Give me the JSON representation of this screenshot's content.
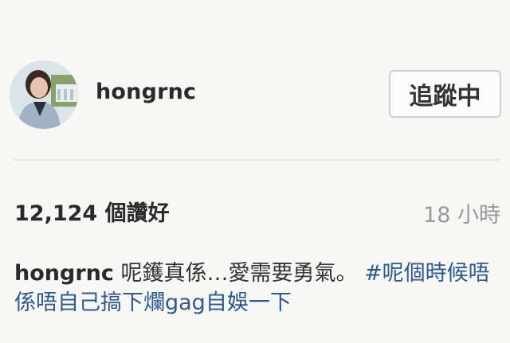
{
  "post": {
    "username": "hongrnc",
    "follow_label": "追蹤中",
    "likes_label": "12,124 個讚好",
    "time_label": "18 小時",
    "caption": {
      "username": "hongrnc",
      "text": "呢鑊真係…愛需要勇氣。",
      "hashtag": "#呢個時候唔係唔自己搞下爛gag自娛一下"
    }
  },
  "colors": {
    "background": "#f7f7f5",
    "hashtag": "#2f5a8c",
    "timestamp": "#9a9a9a"
  }
}
